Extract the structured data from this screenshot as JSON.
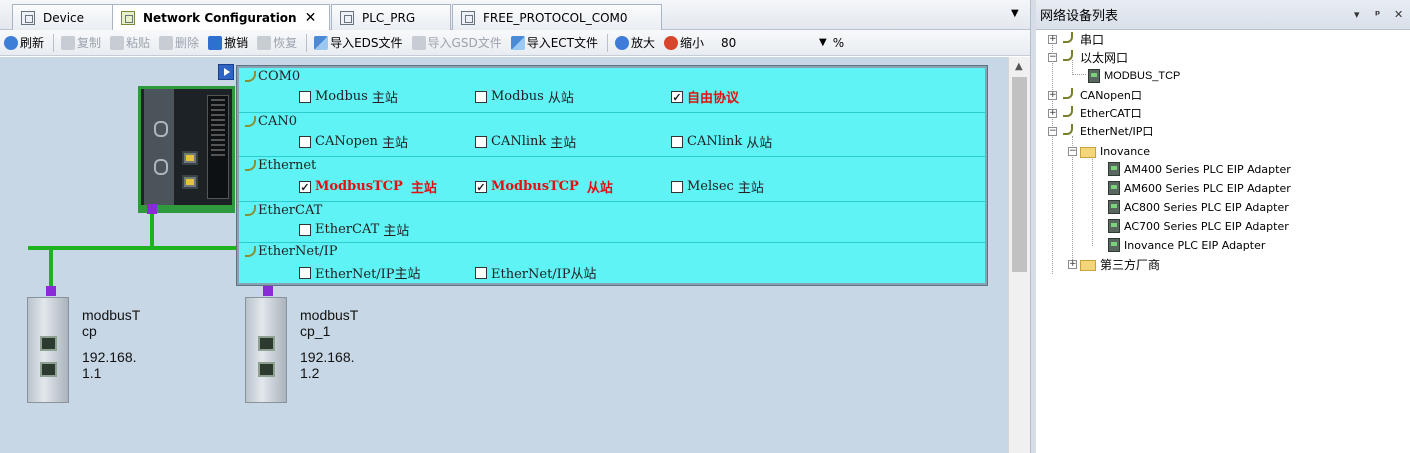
{
  "tabs": [
    {
      "label": "Device",
      "active": false,
      "icon": "device-icon"
    },
    {
      "label": "Network Configuration",
      "active": true,
      "icon": "network-config-icon",
      "closable": true
    },
    {
      "label": "PLC_PRG",
      "active": false,
      "icon": "document-icon"
    },
    {
      "label": "FREE_PROTOCOL_COM0",
      "active": false,
      "icon": "document-icon"
    }
  ],
  "toolbar": {
    "refresh": "刷新",
    "copy": "复制",
    "paste": "粘贴",
    "delete": "删除",
    "undo": "撤销",
    "redo": "恢复",
    "import_eds": "导入EDS文件",
    "import_gsd": "导入GSD文件",
    "import_ect": "导入ECT文件",
    "zoom_in": "放大",
    "zoom_out": "缩小",
    "zoom_value": "80",
    "zoom_unit": "%"
  },
  "protocols": {
    "com0": {
      "title": "COM0",
      "modbus_master": {
        "name": "Modbus",
        "zh": "主站",
        "checked": false
      },
      "modbus_slave": {
        "name": "Modbus",
        "zh": "从站",
        "checked": false
      },
      "free_protocol": {
        "name": "自由协议",
        "checked": true
      }
    },
    "can0": {
      "title": "CAN0",
      "canopen_master": {
        "name": "CANopen",
        "zh": "主站",
        "checked": false
      },
      "canlink_master": {
        "name": "CANlink",
        "zh": "主站",
        "checked": false
      },
      "canlink_slave": {
        "name": "CANlink",
        "zh": "从站",
        "checked": false
      }
    },
    "ethernet": {
      "title": "Ethernet",
      "modbustcp_master": {
        "name": "ModbusTCP",
        "zh": "主站",
        "checked": true
      },
      "modbustcp_slave": {
        "name": "ModbusTCP",
        "zh": "从站",
        "checked": true
      },
      "melsec_master": {
        "name": "Melsec",
        "zh": "主站",
        "checked": false
      }
    },
    "ethercat": {
      "title": "EtherCAT",
      "ethercat_master": {
        "name": "EtherCAT",
        "zh": "主站",
        "checked": false
      }
    },
    "ethernetip": {
      "title": "EtherNet/IP",
      "eip_master": {
        "name": "EtherNet/IP主站",
        "checked": false
      },
      "eip_slave": {
        "name": "EtherNet/IP从站",
        "checked": false
      }
    }
  },
  "slaves": [
    {
      "name_line1": "modbusT",
      "name_line2": "cp",
      "ip_line1": "192.168.",
      "ip_line2": "1.1"
    },
    {
      "name_line1": "modbusT",
      "name_line2": "cp_1",
      "ip_line1": "192.168.",
      "ip_line2": "1.2"
    }
  ],
  "device_list": {
    "title": "网络设备列表",
    "controls": {
      "dropdown": "▾",
      "pin": "ᵖ",
      "close": "✕"
    },
    "nodes": {
      "serial": "串口",
      "ethernet": "以太网口",
      "modbus_tcp": "MODBUS_TCP",
      "canopen": "CANopen口",
      "ethercat": "EtherCAT口",
      "ethernetip": "EtherNet/IP口",
      "inovance": "Inovance",
      "am400": "AM400 Series PLC EIP Adapter",
      "am600": "AM600 Series PLC EIP Adapter",
      "ac800": "AC800 Series PLC EIP Adapter",
      "ac700": "AC700 Series PLC EIP Adapter",
      "inovance_plc": "Inovance PLC EIP Adapter",
      "third_party": "第三方厂商"
    }
  },
  "colors": {
    "canvas_bg": "#c8d7e6",
    "protocol_bg": "#5ff3f5",
    "wire": "#1db31d",
    "connector": "#8a2bd8",
    "selected_text": "#e21010"
  }
}
